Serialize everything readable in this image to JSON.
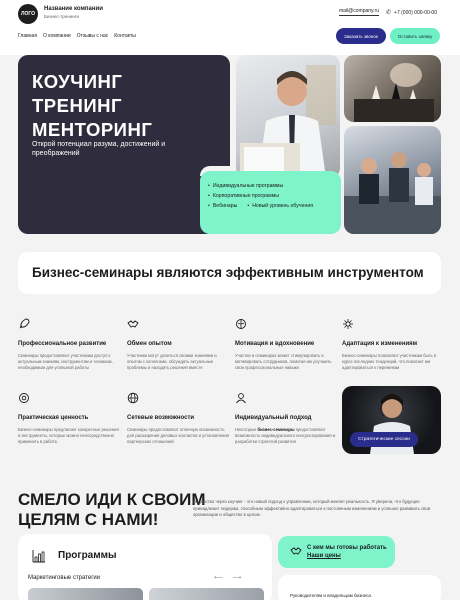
{
  "header": {
    "logo": "ЛОГО",
    "company": "Название компании",
    "company_sub": "Бизнес-тренинги",
    "email": "mail@company.ru",
    "phone": "+7 (000) 000-00-00",
    "nav": [
      "Главная",
      "О компании",
      "Отзывы с нас",
      "Контакты"
    ],
    "call_btn": "Заказать звонок",
    "request_btn": "Оставить заявку"
  },
  "hero": {
    "title_lines": [
      "КОУЧИНГ",
      "ТРЕНИНГ",
      "МЕНТОРИНГ"
    ],
    "subtitle": "Открой потенциал разума, достижений и преображений",
    "list": [
      "Индивидуальные программы",
      "Корпоративные программы",
      "Вебинары",
      "Новый уровень обучения"
    ]
  },
  "banner": "Бизнес-семинары являются эффективным инструментом",
  "features": [
    {
      "icon": "rocket-icon",
      "title": "Профессиональное развитие",
      "desc": "Семинары предоставляют участникам доступ к актуальным знаниям, инструментам и техникам, необходимым для успешной работы"
    },
    {
      "icon": "handshake-icon",
      "title": "Обмен опытом",
      "desc": "Участники могут делиться своими знаниями и опытом с коллегами, обсуждать актуальные проблемы и находить решения вместе"
    },
    {
      "icon": "brain-icon",
      "title": "Мотивация и вдохновение",
      "desc": "Участие в семинарах может стимулировать и мотивировать сотрудников, помогая им улучшить свои профессиональные навыки"
    },
    {
      "icon": "sparkle-icon",
      "title": "Адаптация к изменениям",
      "desc": "Бизнес-семинары позволяют участникам быть в курсе последних тенденций, что помогает им адаптироваться к переменам"
    },
    {
      "icon": "target-icon",
      "title": "Практическая ценность",
      "desc": "Бизнес-семинары предлагают конкретные решения и инструменты, которые можно непосредственно применить в работе."
    },
    {
      "icon": "globe-icon",
      "title": "Сетевые возможности",
      "desc": "Семинары предоставляют отличную возможность для расширения деловых контактов и установления партнерских отношений"
    },
    {
      "icon": "user-icon",
      "title": "Индивидуальный подход",
      "desc_pre": "Некоторые ",
      "desc_bold": "бизнес-семинары",
      "desc_post": " предоставляют возможность индивидуального консультирования и разработки стратегий развития"
    }
  ],
  "session_btn": "Стратегические сессии",
  "bottom": {
    "title_lines": [
      "СМЕЛО ИДИ К СВОИМ",
      "ЦЕЛЯМ С НАМИ!"
    ],
    "desc": "Лидерство через коучинг - это новый подход к управлению, который меняет реальность. Я уверена, что будущее принадлежит лидерам, способным эффективно адаптироваться к постоянным изменениям и успешно развивать свои организации и общество в целом.",
    "programs_title": "Программы",
    "programs_sub": "Маркетинговые стратегии",
    "arrow_left": "⟵",
    "arrow_right": "⟶",
    "who_line1": "С кем мы готовы работать",
    "who_line2": "Наши цены",
    "who_item": "Руководителям и владельцам бизнеса"
  }
}
